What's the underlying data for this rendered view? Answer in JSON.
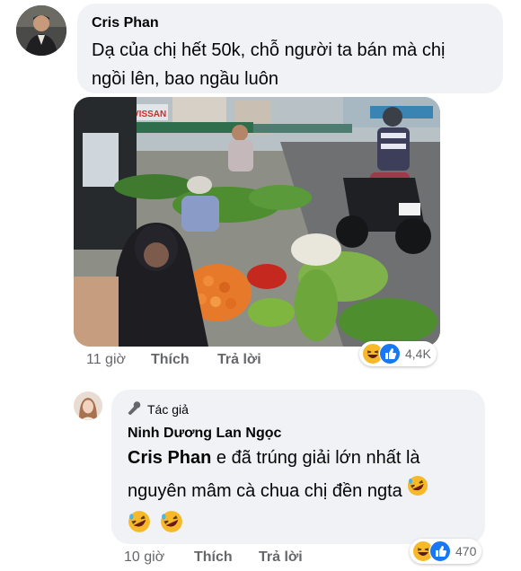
{
  "comment1": {
    "author": "Cris Phan",
    "text_line1": "Dạ của chị hết 50k, chỗ người ta bán mà chị",
    "text_line2": "ngồi lên, bao ngầu luôn",
    "time": "11 giờ",
    "like_label": "Thích",
    "reply_label": "Trả lời",
    "reaction_count": "4,4K",
    "reactions": [
      "haha-icon",
      "like-icon"
    ]
  },
  "comment2": {
    "badge": "Tác giả",
    "author": "Ninh Dương Lan Ngọc",
    "mention": "Cris Phan",
    "text_line1_rest": " e đã trúng giải lớn nhất là",
    "text_line2": "nguyên mâm cà chua chị đền ngta",
    "time": "10 giờ",
    "like_label": "Thích",
    "reply_label": "Trả lời",
    "reaction_count": "470",
    "reactions": [
      "haha-icon",
      "like-icon"
    ]
  },
  "colors": {
    "bubble": "#f0f2f5",
    "meta": "#65676b",
    "like_blue": "#1877f2",
    "haha_yellow": "#f7b928"
  }
}
